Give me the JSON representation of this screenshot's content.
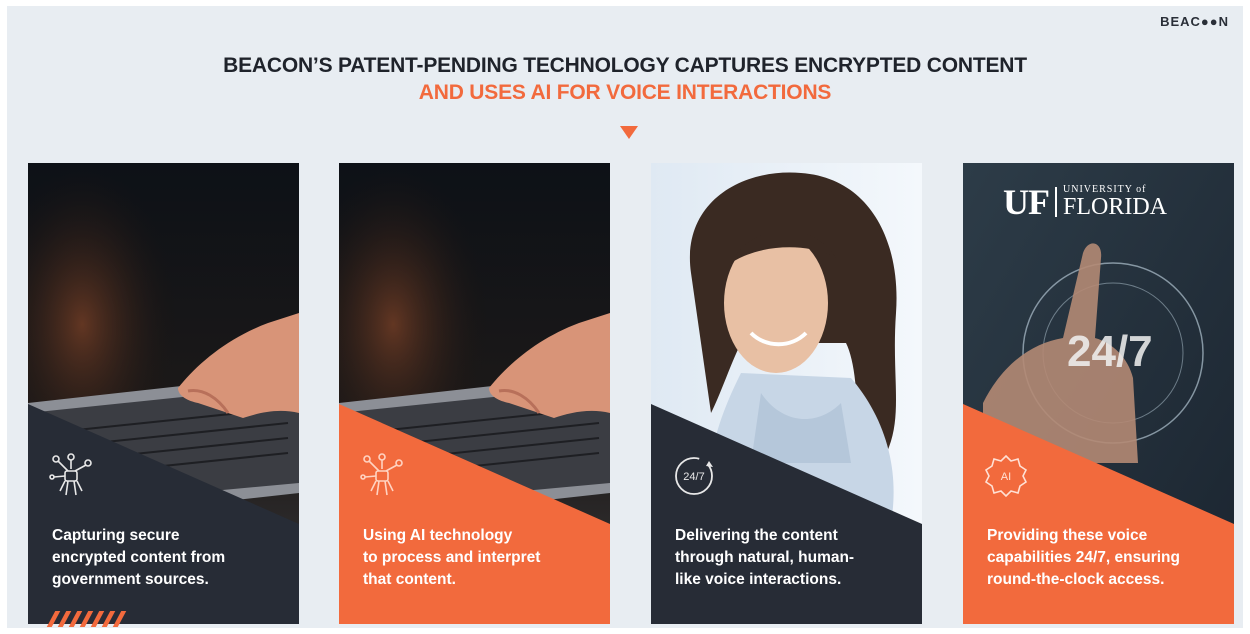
{
  "logo": "BEAC●●N",
  "headline": "BEACON’S PATENT-PENDING TECHNOLOGY CAPTURES ENCRYPTED CONTENT",
  "subheadline": "AND USES AI FOR VOICE INTERACTIONS",
  "colors": {
    "accent": "#f26a3d",
    "dark": "#272c36",
    "background": "#e8edf2"
  },
  "cards": [
    {
      "icon": "network-robot-hand-icon",
      "panel_color": "dark",
      "text_lines": [
        "Capturing secure",
        "encrypted content from",
        "government sources."
      ]
    },
    {
      "icon": "network-robot-hand-icon",
      "panel_color": "orange",
      "text_lines": [
        "Using AI technology",
        "to process and interpret",
        "that content."
      ]
    },
    {
      "icon": "clock-24-7-icon",
      "icon_label": "24/7",
      "panel_color": "dark",
      "text_lines": [
        "Delivering the content",
        "through natural, human-",
        "like voice interactions."
      ]
    },
    {
      "icon": "ai-badge-icon",
      "icon_label": "AI",
      "panel_color": "orange",
      "logo_uf": "UF",
      "logo_university": "UNIVERSITY of",
      "logo_florida": "FLORIDA",
      "overlay_text": "24/7",
      "text_lines": [
        "Providing these voice",
        "capabilities 24/7, ensuring",
        "round-the-clock access."
      ]
    }
  ]
}
